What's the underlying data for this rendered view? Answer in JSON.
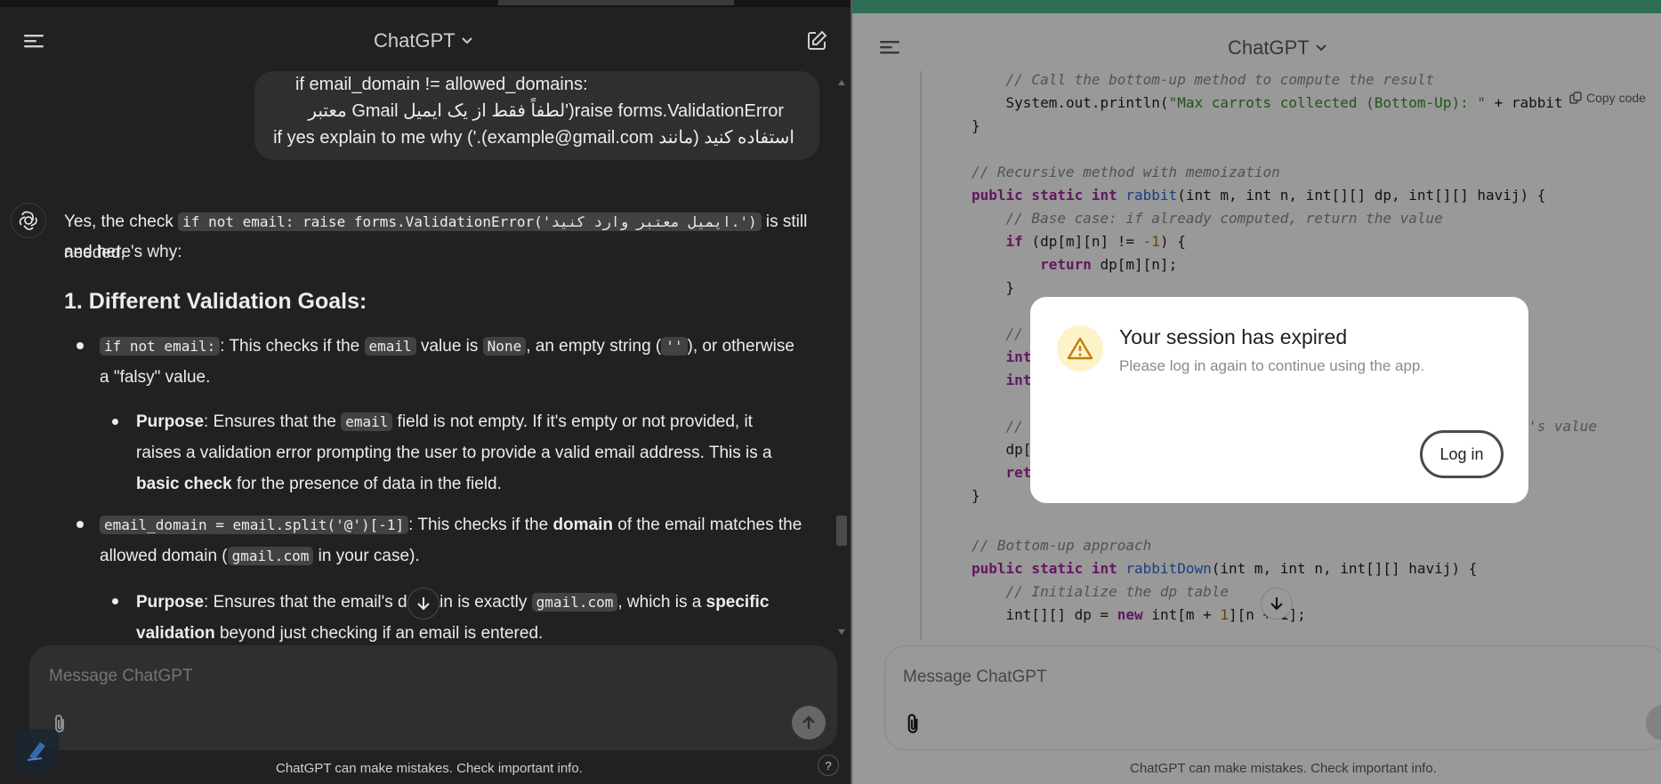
{
  "left": {
    "header": {
      "title": "ChatGPT"
    },
    "user_message": {
      "line1": "if email_domain != allowed_domains:",
      "line2": "raise forms.ValidationError('لطفاً فقط از یک ایمیل Gmail معتبر",
      "line3": "استفاده کنید (مانند example@gmail.com).') if yes explain to me why"
    },
    "answer": {
      "intro_pre": "Yes, the check ",
      "intro_code": "if not email: raise forms.ValidationError('ایمیل معتبر وارد کنید.')",
      "intro_post": " is still needed,",
      "intro_line2": "and here's why:",
      "heading": "1. Different Validation Goals:",
      "b1_code": "if not email:",
      "b1_text1": ": This checks if the ",
      "b1_code2": "email",
      "b1_text2": " value is ",
      "b1_code3": "None",
      "b1_text3": ", an empty string (",
      "b1_code4": "''",
      "b1_text4": "), or otherwise",
      "b1_line2": "a \"falsy\" value.",
      "b1a_bold": "Purpose",
      "b1a_text1": ": Ensures that the ",
      "b1a_code": "email",
      "b1a_text2": " field is not empty. If it's empty or not provided, it",
      "b1a_line2": "raises a validation error prompting the user to provide a valid email address. This is a",
      "b1a_line3_bold": "basic check",
      "b1a_line3": " for the presence of data in the field.",
      "b2_code": "email_domain = email.split('@')[-1]",
      "b2_text1": ": This checks if the ",
      "b2_bold": "domain",
      "b2_text2": " of the email matches the",
      "b2_line2_pre": "allowed domain (",
      "b2_line2_code": "gmail.com",
      "b2_line2_post": " in your case).",
      "b2a_bold": "Purpose",
      "b2a_text1": ": Ensures that the email's d",
      "b2a_text1b": "ain is exactly ",
      "b2a_code": "gmail.com",
      "b2a_text2": ", which is a ",
      "b2a_bold2": "specific",
      "b2a_line2_bold": "validation",
      "b2a_line2": " beyond just checking if an email is entered."
    },
    "composer": {
      "placeholder": "Message ChatGPT"
    },
    "footer": {
      "note": "ChatGPT can make mistakes. Check important info.",
      "help": "?"
    }
  },
  "right": {
    "header": {
      "title": "ChatGPT"
    },
    "code_lines": {
      "l0": "    // Call the bottom-up method to compute the result",
      "l1_pre": "    System.out.println(",
      "l1_str": "\"Max carrots collected (Bottom-Up): \"",
      "l1_post": " + rabbit",
      "copy": "Copy code",
      "l2": "}",
      "l3": "// Recursive method with memoization",
      "l4_kw": "public static int ",
      "l4_fn": "rabbit",
      "l4_rest": "(int m, int n, int[][] dp, int[][] havij) {",
      "l5": "    // Base case: if already computed, return the value",
      "l6_kw": "    if ",
      "l6_rest": "(dp[m][n] != ",
      "l6_num": "-1",
      "l6_end": ") {",
      "l7_kw": "        return ",
      "l7_rest": "dp[m][n];",
      "l8": "    }",
      "l9": "    //",
      "l10": "    int",
      "l11": "    int",
      "l12": "    //",
      "l12_tail": "'s value",
      "l13": "    dp[",
      "l14": "    ret",
      "l15": "}",
      "l16": "// Bottom-up approach",
      "l17_kw": "public static int ",
      "l17_fn": "rabbitDown",
      "l17_rest": "(int m, int n, int[][] havij) {",
      "l18": "    // Initialize the dp table",
      "l19_pre": "    int[][] dp = ",
      "l19_kw": "new",
      "l19_rest": " int[m + ",
      "l19_num": "1",
      "l19_end": "][n + 1];"
    },
    "modal": {
      "title": "Your session has expired",
      "message": "Please log in again to continue using the app.",
      "button": "Log in"
    },
    "composer": {
      "placeholder": "Message ChatGPT"
    },
    "footer": {
      "note": "ChatGPT can make mistakes. Check important info."
    }
  }
}
